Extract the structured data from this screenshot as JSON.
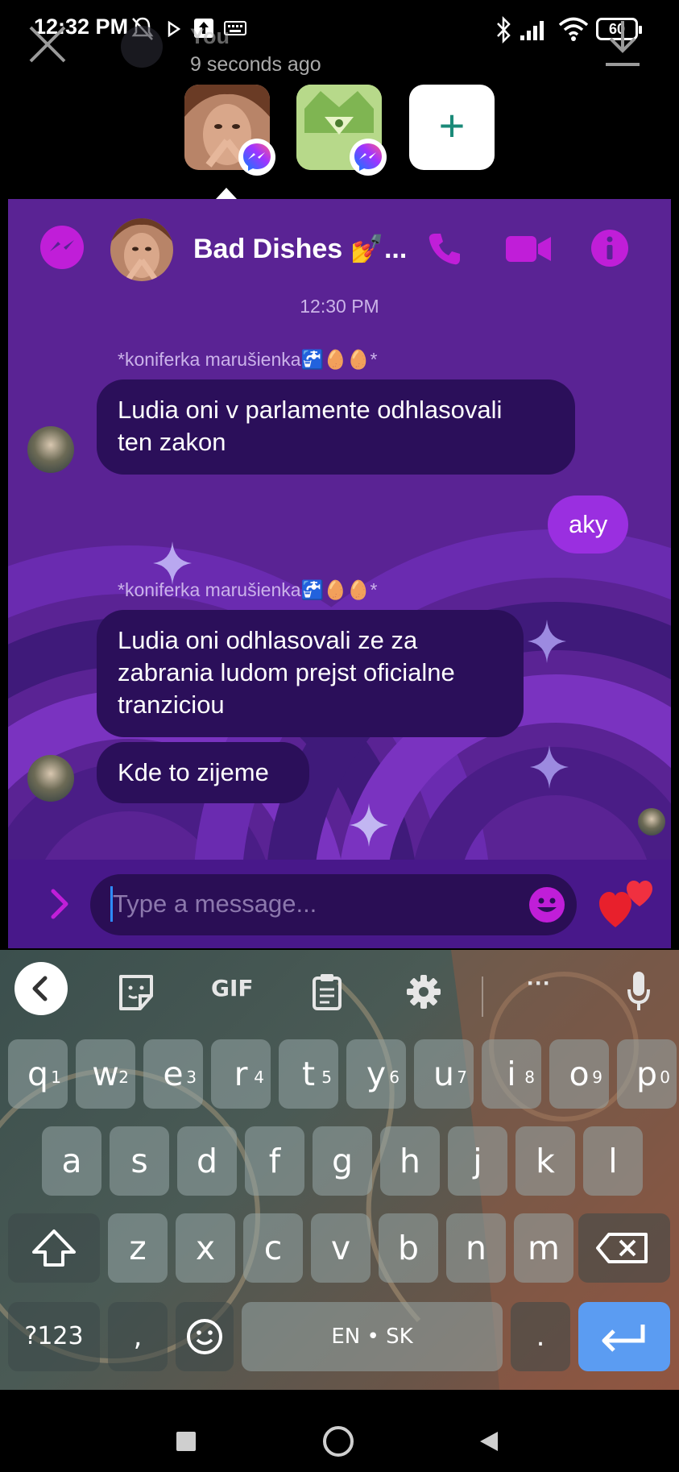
{
  "status_bar": {
    "time": "12:32 PM",
    "battery": "60"
  },
  "story_header": {
    "name": "You",
    "timestamp": "9 seconds ago"
  },
  "top_bar": {
    "add_label": "+"
  },
  "chat": {
    "title": "Bad Dishes 💅...",
    "time_separator": "12:30 PM",
    "messages": [
      {
        "sender": "*koniferka marušienka🚰🥚🥚*",
        "text_lines": [
          "Ludia oni v parlamente odhlasovali",
          "ten zakon"
        ]
      },
      {
        "outgoing": true,
        "text": "aky"
      },
      {
        "sender": "*koniferka marušienka🚰🥚🥚*",
        "text_lines": [
          "Ludia oni odhlasovali ze za",
          "zabrania ludom prejst oficialne",
          "tranziciou"
        ]
      },
      {
        "text": "Kde to zijeme"
      }
    ],
    "input_placeholder": "Type a message..."
  },
  "keyboard": {
    "toolbar": {
      "gif_label": "GIF",
      "more_label": "···"
    },
    "row1": [
      {
        "k": "q",
        "h": "1"
      },
      {
        "k": "w",
        "h": "2"
      },
      {
        "k": "e",
        "h": "3"
      },
      {
        "k": "r",
        "h": "4"
      },
      {
        "k": "t",
        "h": "5"
      },
      {
        "k": "y",
        "h": "6"
      },
      {
        "k": "u",
        "h": "7"
      },
      {
        "k": "i",
        "h": "8"
      },
      {
        "k": "o",
        "h": "9"
      },
      {
        "k": "p",
        "h": "0"
      }
    ],
    "row2": [
      "a",
      "s",
      "d",
      "f",
      "g",
      "h",
      "j",
      "k",
      "l"
    ],
    "row3": [
      "z",
      "x",
      "c",
      "v",
      "b",
      "n",
      "m"
    ],
    "symbols_label": "?123",
    "comma_label": ",",
    "space_label": "EN • SK",
    "period_label": "."
  },
  "colors": {
    "chat_bg": "#5a2394",
    "bubble_in": "#2b0f5a",
    "bubble_out": "#9a2fe0",
    "accent_magenta": "#c01ed8",
    "enter_key": "#5b9cf2"
  }
}
